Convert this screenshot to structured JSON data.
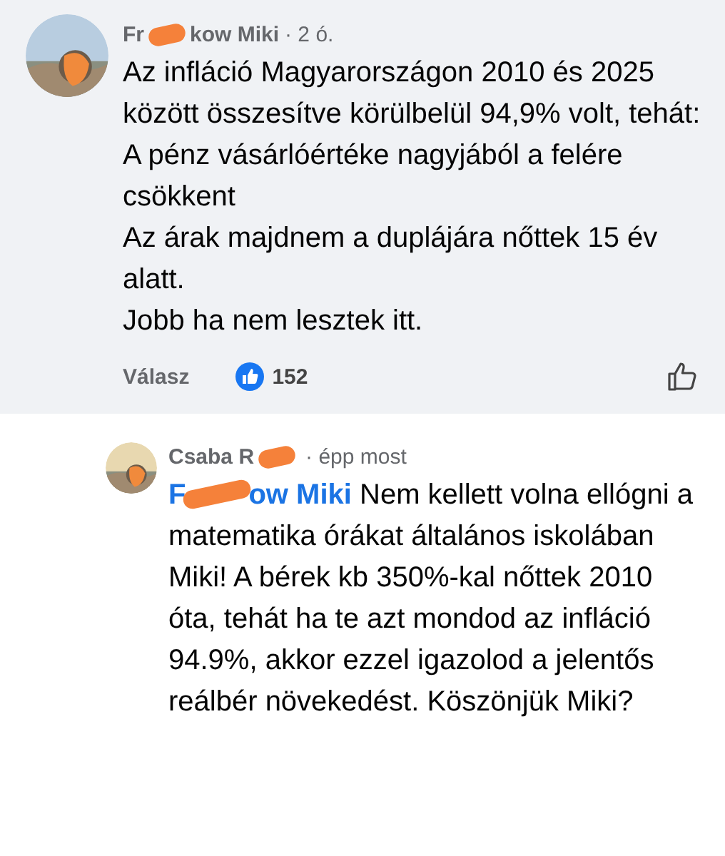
{
  "comment": {
    "author_start": "Fr",
    "author_end": "kow Miki",
    "time": "· 2 ó.",
    "paragraphs": [
      "Az infláció Magyarországon 2010 és 2025 között összesítve körülbelül 94,9% volt, tehát:",
      "A pénz vásárlóértéke nagyjából a felére csökkent",
      "Az árak majdnem a duplájára nőttek 15 év alatt.",
      "Jobb ha nem lesztek itt."
    ],
    "reply_label": "Válasz",
    "like_count": "152",
    "liked": false
  },
  "reply": {
    "author_start": "Csaba R",
    "time": "· épp most",
    "mention_start": "F",
    "mention_end": "ow Miki",
    "text": " Nem kellett volna ellógni a matematika órákat általános iskolában Miki! A bérek kb 350%-kal nőttek 2010 óta, tehát ha te azt mondod az infláció 94.9%, akkor ezzel igazolod a jelentős reálbér növekedést. Köszönjük Miki?"
  }
}
